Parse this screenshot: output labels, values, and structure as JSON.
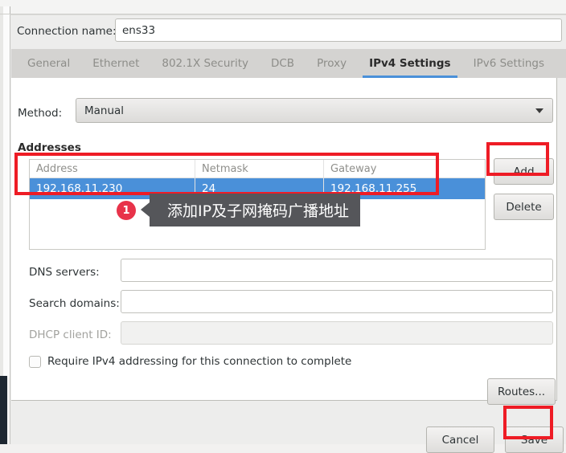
{
  "dialog": {
    "connection_name_label": "Connection name:",
    "connection_name_value": "ens33"
  },
  "tabs": [
    {
      "label": "General",
      "active": false
    },
    {
      "label": "Ethernet",
      "active": false
    },
    {
      "label": "802.1X Security",
      "active": false
    },
    {
      "label": "DCB",
      "active": false
    },
    {
      "label": "Proxy",
      "active": false
    },
    {
      "label": "IPv4 Settings",
      "active": true
    },
    {
      "label": "IPv6 Settings",
      "active": false
    }
  ],
  "method": {
    "label": "Method:",
    "value": "Manual"
  },
  "addresses": {
    "title": "Addresses",
    "columns": [
      "Address",
      "Netmask",
      "Gateway"
    ],
    "rows": [
      {
        "address": "192.168.11.230",
        "netmask": "24",
        "gateway": "192.168.11.255",
        "selected": true
      }
    ],
    "add_label": "Add",
    "delete_label": "Delete"
  },
  "form": {
    "dns_label": "DNS servers:",
    "dns_value": "",
    "search_label": "Search domains:",
    "search_value": "",
    "dhcp_label": "DHCP client ID:",
    "dhcp_value": "",
    "require_label": "Require IPv4 addressing for this connection to complete",
    "routes_label": "Routes..."
  },
  "actions": {
    "cancel_label": "Cancel",
    "save_label": "Save"
  },
  "annotation": {
    "badge": "1",
    "text": "添加IP及子网掩码广播地址"
  },
  "colors": {
    "accent_blue": "#4a90d9",
    "annotation_red": "#ee1c25",
    "badge_red": "#e8334a",
    "callout_gray": "#55565a"
  }
}
